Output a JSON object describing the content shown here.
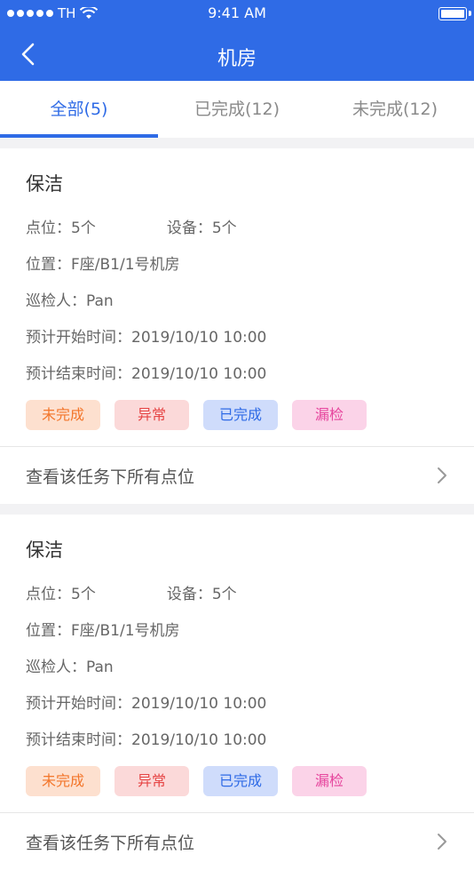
{
  "status_bar": {
    "carrier": "TH",
    "time": "9:41 AM"
  },
  "nav": {
    "title": "机房"
  },
  "tabs": [
    {
      "label": "全部(5)",
      "active": true
    },
    {
      "label": "已完成(12)",
      "active": false
    },
    {
      "label": "未完成(12)",
      "active": false
    }
  ],
  "cards": [
    {
      "title": "保洁",
      "points_label": "点位：5个",
      "devices_label": "设备：5个",
      "location": "位置：F座/B1/1号机房",
      "inspector": "巡检人：Pan",
      "start": "预计开始时间：2019/10/10 10:00",
      "end": "预计结束时间：2019/10/10 10:00",
      "tags": [
        "未完成",
        "异常",
        "已完成",
        "漏检"
      ],
      "footer": "查看该任务下所有点位"
    },
    {
      "title": "保洁",
      "points_label": "点位：5个",
      "devices_label": "设备：5个",
      "location": "位置：F座/B1/1号机房",
      "inspector": "巡检人：Pan",
      "start": "预计开始时间：2019/10/10 10:00",
      "end": "预计结束时间：2019/10/10 10:00",
      "tags": [
        "未完成",
        "异常",
        "已完成",
        "漏检"
      ],
      "footer": "查看该任务下所有点位"
    }
  ],
  "colors": {
    "primary": "#2f6be6",
    "tag_orange": "#f3762b",
    "tag_red": "#e64545",
    "tag_blue": "#2f6be6",
    "tag_pink": "#e6459d"
  }
}
